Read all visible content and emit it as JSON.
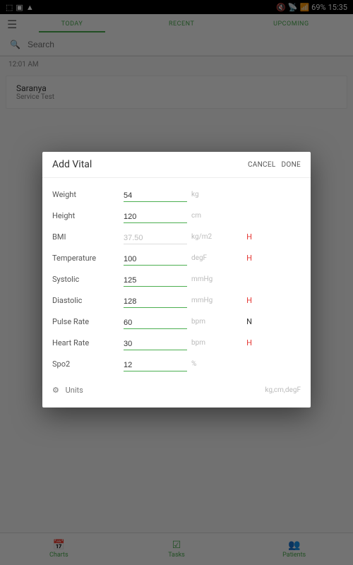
{
  "status": {
    "left_icons": [
      "⬚",
      "▣",
      "▲"
    ],
    "right_text": "69%",
    "time": "15:35",
    "signal": "📶",
    "wifi": "📡",
    "mute": "🔇"
  },
  "header": {
    "tabs": [
      {
        "label": "TODAY",
        "active": true
      },
      {
        "label": "RECENT",
        "active": false
      },
      {
        "label": "UPCOMING",
        "active": false
      }
    ]
  },
  "search": {
    "placeholder": "Search"
  },
  "timeline": {
    "time": "12:01 AM"
  },
  "card": {
    "title": "Saranya",
    "subtitle": "Service Test"
  },
  "dialog": {
    "title": "Add Vital",
    "cancel": "CANCEL",
    "done": "DONE",
    "rows": [
      {
        "label": "Weight",
        "value": "54",
        "unit": "kg",
        "flag": "",
        "readonly": false
      },
      {
        "label": "Height",
        "value": "120",
        "unit": "cm",
        "flag": "",
        "readonly": false
      },
      {
        "label": "BMI",
        "value": "37.50",
        "unit": "kg/m2",
        "flag": "H",
        "readonly": true
      },
      {
        "label": "Temperature",
        "value": "100",
        "unit": "degF",
        "flag": "H",
        "readonly": false
      },
      {
        "label": "Systolic",
        "value": "125",
        "unit": "mmHg",
        "flag": "",
        "readonly": false
      },
      {
        "label": "Diastolic",
        "value": "128",
        "unit": "mmHg",
        "flag": "H",
        "readonly": false
      },
      {
        "label": "Pulse Rate",
        "value": "60",
        "unit": "bpm",
        "flag": "N",
        "readonly": false
      },
      {
        "label": "Heart Rate",
        "value": "30",
        "unit": "bpm",
        "flag": "H",
        "readonly": false
      },
      {
        "label": "Spo2",
        "value": "12",
        "unit": "%",
        "flag": "",
        "readonly": false
      }
    ],
    "units_label": "Units",
    "units_value": "kg,cm,degF"
  },
  "bottomnav": {
    "items": [
      {
        "label": "Charts",
        "icon": "📅"
      },
      {
        "label": "Tasks",
        "icon": "☑"
      },
      {
        "label": "Patients",
        "icon": "👥"
      }
    ]
  }
}
